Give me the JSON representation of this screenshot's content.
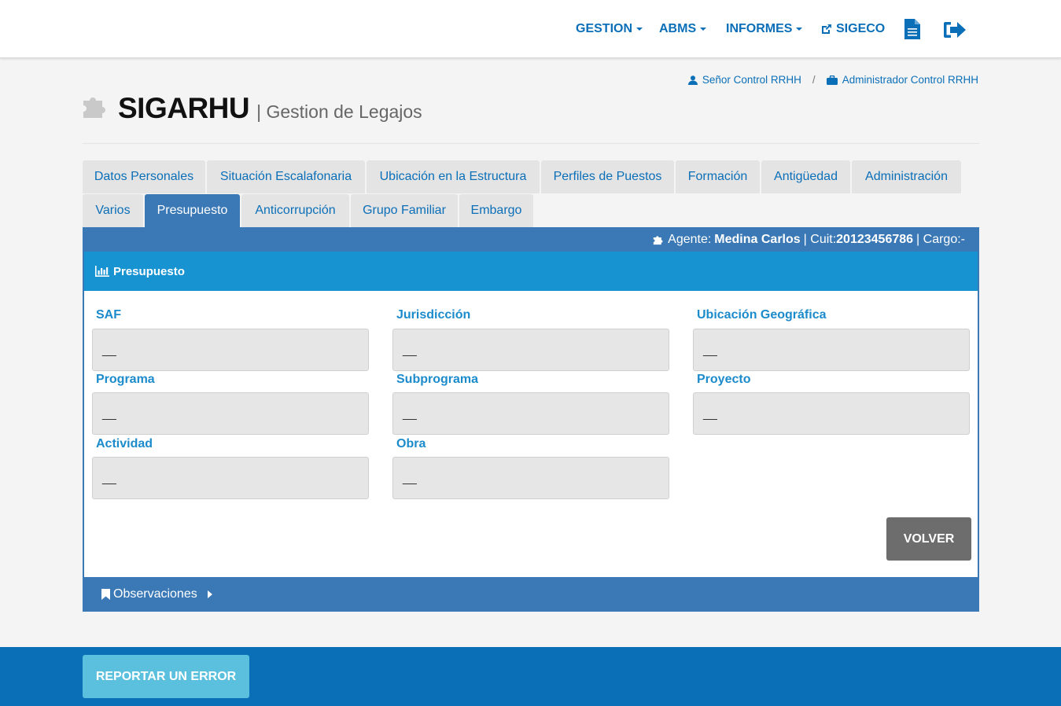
{
  "nav": {
    "gestion": "GESTION",
    "abms": "ABMS",
    "informes": "INFORMES",
    "sigeco": "SIGECO",
    "document_icon": "file-text-icon",
    "logout_icon": "sign-out-icon"
  },
  "header": {
    "user_name": "Señor Control RRHH",
    "user_role": "Administrador Control RRHH",
    "app_title": "SIGARHU",
    "app_subtitle": "| Gestion de Legajos"
  },
  "tabs": [
    {
      "label": "Datos Personales"
    },
    {
      "label": "Situación Escalafonaria"
    },
    {
      "label": "Ubicación en la Estructura"
    },
    {
      "label": "Perfiles de Puestos"
    },
    {
      "label": "Formación"
    },
    {
      "label": "Antigüedad"
    },
    {
      "label": "Administración"
    },
    {
      "label": "Varios"
    },
    {
      "label": "Presupuesto",
      "active": true
    },
    {
      "label": "Anticorrupción"
    },
    {
      "label": "Grupo Familiar"
    },
    {
      "label": "Embargo"
    }
  ],
  "agent": {
    "agent_label": "Agente:",
    "agent_name": "Medina Carlos",
    "cuit_label": "| Cuit:",
    "cuit_value": "20123456786",
    "cargo_label": "| Cargo:-"
  },
  "panel": {
    "title": "Presupuesto",
    "fields": [
      {
        "label": "SAF",
        "value": "__"
      },
      {
        "label": "Jurisdicción",
        "value": "__"
      },
      {
        "label": "Ubicación Geográfica",
        "value": "__"
      },
      {
        "label": "Programa",
        "value": "__"
      },
      {
        "label": "Subprograma",
        "value": "__"
      },
      {
        "label": "Proyecto",
        "value": "__"
      },
      {
        "label": "Actividad",
        "value": "__"
      },
      {
        "label": "Obra",
        "value": "__"
      }
    ],
    "back_button": "VOLVER"
  },
  "observaciones": {
    "label": "Observaciones"
  },
  "footer": {
    "report_button": "REPORTAR UN ERROR"
  },
  "colors": {
    "primary": "#0b6fb8",
    "tab_active": "#3b79b6",
    "panel_head": "#1893d2",
    "report": "#5bc0de"
  }
}
